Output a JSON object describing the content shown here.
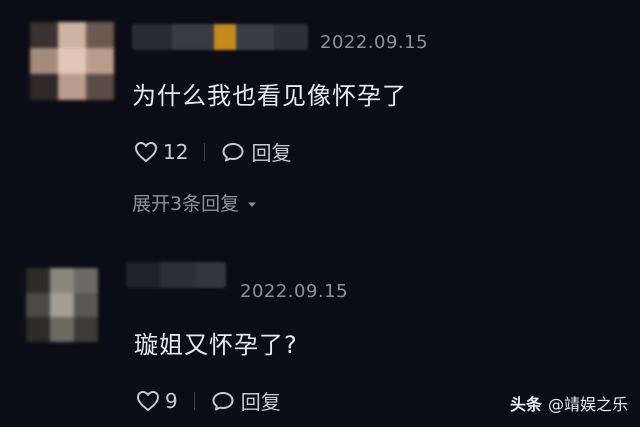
{
  "comments": [
    {
      "timestamp": "2022.09.15",
      "text": "为什么我也看见像怀孕了",
      "like_count": "12",
      "reply_label": "回复",
      "expand_replies_label": "展开3条回复"
    },
    {
      "timestamp": "2022.09.15",
      "text": "璇姐又怀孕了?",
      "like_count": "9",
      "reply_label": "回复"
    }
  ],
  "watermark": {
    "brand": "头条",
    "handle": "@靖娱之乐"
  },
  "colors": {
    "background": "#0c0d14",
    "text_primary": "#e9eaf0",
    "text_secondary": "#8d8f9b",
    "avatar1_palette": [
      "#6b5a4f",
      "#a48a7a",
      "#cdb3a2",
      "#3a3230",
      "#b89c8c",
      "#e2c7b7"
    ],
    "avatar2_palette": [
      "#4b4a47",
      "#6d6a64",
      "#8a877f",
      "#2d2c2a",
      "#a29e95",
      "#5a5853"
    ],
    "username1_palette": [
      "#2a2b33",
      "#383a44",
      "#c58a1e",
      "#3b3d47",
      "#2f3039"
    ],
    "username2_palette": [
      "#1f2029",
      "#2d2e37",
      "#34363f"
    ]
  },
  "icons": {
    "like": "heart-outline-icon",
    "reply": "speech-bubble-icon",
    "expand": "chevron-down-icon"
  }
}
